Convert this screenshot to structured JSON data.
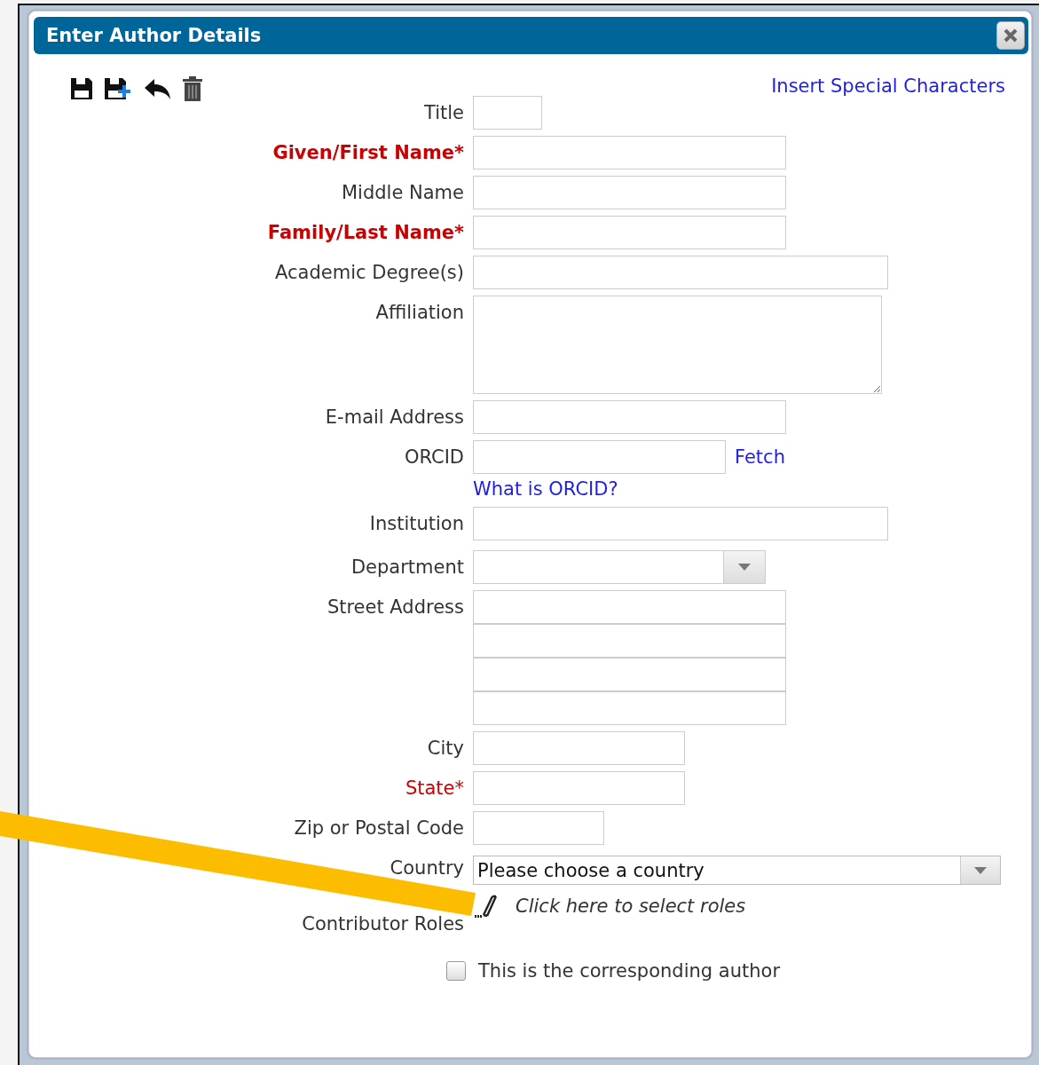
{
  "window": {
    "title": "Enter Author Details"
  },
  "insert_link": "Insert Special Characters",
  "fields": [
    {
      "label": "Title",
      "required": false,
      "kind": "title"
    },
    {
      "label": "Given/First Name*",
      "required": true,
      "kind": "text"
    },
    {
      "label": "Middle Name",
      "required": false,
      "kind": "text"
    },
    {
      "label": "Family/Last Name*",
      "required": true,
      "kind": "text"
    },
    {
      "label": "Academic Degree(s)",
      "required": false,
      "kind": "wide-text"
    },
    {
      "label": "Affiliation",
      "required": false,
      "kind": "textarea"
    },
    {
      "label": "E-mail Address",
      "required": false,
      "kind": "text"
    },
    {
      "label": "ORCID",
      "required": false,
      "kind": "orcid",
      "action": "Fetch",
      "help_link": "What is ORCID?"
    },
    {
      "label": "Institution",
      "required": false,
      "kind": "wide-text"
    },
    {
      "label": "Department",
      "required": false,
      "kind": "select"
    },
    {
      "label": "Street Address",
      "required": false,
      "kind": "address"
    },
    {
      "label": "City",
      "required": false,
      "kind": "city"
    },
    {
      "label": "State*",
      "required": true,
      "kind": "city"
    },
    {
      "label": "Zip or Postal Code",
      "required": false,
      "kind": "zip"
    },
    {
      "label": "Country",
      "required": false,
      "kind": "country",
      "value": "Please choose a country"
    },
    {
      "label": "Contributor Roles",
      "required": false,
      "kind": "roles",
      "value": "Click here to select roles"
    }
  ],
  "corresponding": {
    "label": "This is the corresponding author",
    "checked": false
  }
}
